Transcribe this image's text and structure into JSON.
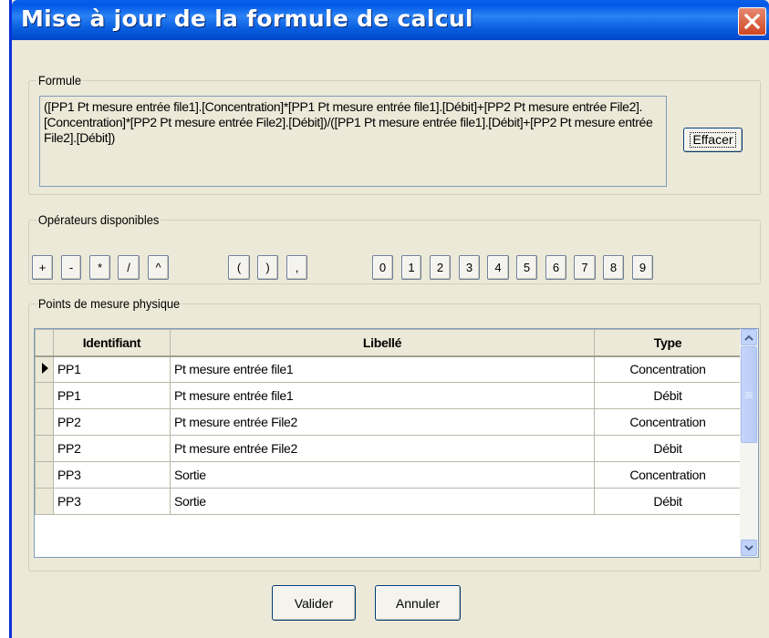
{
  "window": {
    "title": "Mise à jour de la formule de calcul"
  },
  "formule": {
    "legend": "Formule",
    "text": "([PP1 Pt mesure entrée file1].[Concentration]*[PP1 Pt mesure entrée file1].[Débit]+[PP2 Pt mesure entrée File2].[Concentration]*[PP2 Pt mesure entrée File2].[Débit])/([PP1 Pt mesure entrée file1].[Débit]+[PP2 Pt mesure entrée File2].[Débit])",
    "clear_label": "Effacer"
  },
  "operateurs": {
    "legend": "Opérateurs disponibles",
    "buttons": [
      "+",
      "-",
      "*",
      "/",
      "^",
      "(",
      ")",
      ",",
      "0",
      "1",
      "2",
      "3",
      "4",
      "5",
      "6",
      "7",
      "8",
      "9"
    ]
  },
  "points": {
    "legend": "Points de mesure physique",
    "columns": [
      "Identifiant",
      "Libellé",
      "Type"
    ],
    "rows": [
      {
        "id": "PP1",
        "libelle": "Pt mesure entrée file1",
        "type": "Concentration"
      },
      {
        "id": "PP1",
        "libelle": "Pt mesure entrée file1",
        "type": "Débit"
      },
      {
        "id": "PP2",
        "libelle": "Pt mesure entrée File2",
        "type": "Concentration"
      },
      {
        "id": "PP2",
        "libelle": "Pt mesure entrée File2",
        "type": "Débit"
      },
      {
        "id": "PP3",
        "libelle": "Sortie",
        "type": "Concentration"
      },
      {
        "id": "PP3",
        "libelle": "Sortie",
        "type": "Débit"
      }
    ],
    "selected_row": 0
  },
  "footer": {
    "validate_label": "Valider",
    "cancel_label": "Annuler"
  },
  "icons": {
    "close": "close-icon",
    "row_pointer": "row-pointer-icon",
    "scroll_up": "chevron-up-icon",
    "scroll_down": "chevron-down-icon"
  },
  "colors": {
    "titlebar": "#0058e6",
    "dialog_bg": "#ece9d8",
    "close_button": "#d0461f"
  }
}
